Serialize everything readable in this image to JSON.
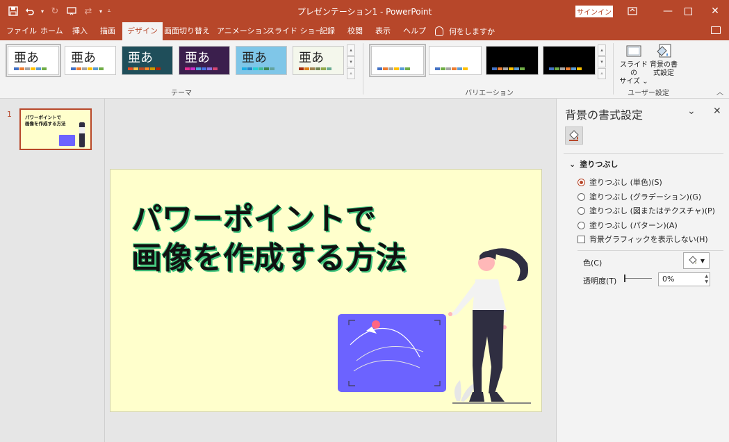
{
  "app": {
    "document_title": "プレゼンテーション1 - PowerPoint",
    "signin_label": "サインイン"
  },
  "tabs": [
    "ファイル",
    "ホーム",
    "挿入",
    "描画",
    "デザイン",
    "画面切り替え",
    "アニメーション",
    "スライド ショー",
    "記録",
    "校閲",
    "表示",
    "ヘルプ"
  ],
  "active_tab": "デザイン",
  "tell_me": "何をしますか",
  "ribbon": {
    "theme_glyph": "亜あ",
    "themes_label": "テーマ",
    "variations_label": "バリエーション",
    "customize_label": "ユーザー設定",
    "slide_size_label": "スライドの\nサイズ ⌄",
    "format_bg_label": "背景の書\n式設定"
  },
  "thumbnail": {
    "slide_number": "1",
    "title_line1": "パワーポイントで",
    "title_line2": "画像を作成する方法"
  },
  "slide": {
    "title_line1": "パワーポイントで",
    "title_line2": "画像を作成する方法"
  },
  "pane": {
    "title": "背景の書式設定",
    "section": "塗りつぶし",
    "options": [
      "塗りつぶし (単色)(S)",
      "塗りつぶし (グラデーション)(G)",
      "塗りつぶし (図またはテクスチャ)(P)",
      "塗りつぶし (パターン)(A)"
    ],
    "hide_graphics": "背景グラフィックを表示しない(H)",
    "color_label": "色(C)",
    "transparency_label": "透明度(T)",
    "transparency_value": "0%"
  },
  "colors": {
    "accent": "#b7472a",
    "slide_bg": "#ffffcc",
    "title_glow": "#3ec47c",
    "illustration": "#6c63ff"
  }
}
